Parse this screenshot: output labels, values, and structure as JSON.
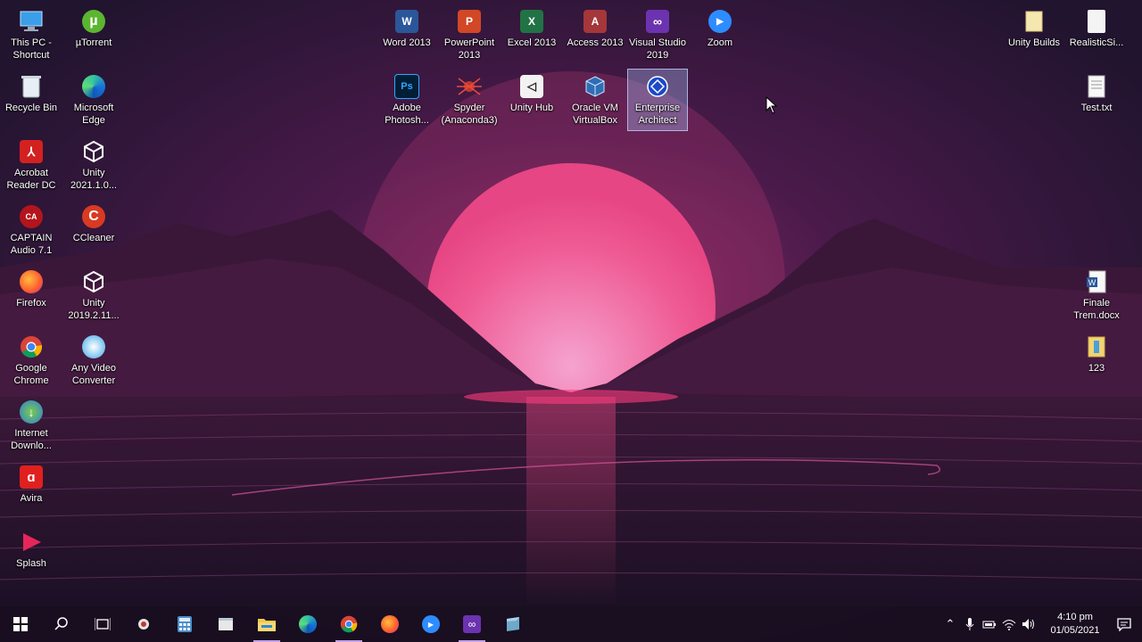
{
  "desktop": {
    "icons": {
      "this_pc": "This PC -\nShortcut",
      "utorrent": "µTorrent",
      "recycle_bin": "Recycle Bin",
      "edge": "Microsoft\nEdge",
      "acrobat": "Acrobat\nReader DC",
      "unity_2021": "Unity\n2021.1.0...",
      "captain_audio": "CAPTAIN\nAudio 7.1",
      "ccleaner": "CCleaner",
      "firefox": "Firefox",
      "unity_2019": "Unity\n2019.2.11...",
      "chrome": "Google\nChrome",
      "any_video": "Any Video\nConverter",
      "idm": "Internet\nDownlo...",
      "avira": "Avira",
      "splash": "Splash",
      "word": "Word 2013",
      "powerpoint": "PowerPoint\n2013",
      "excel": "Excel 2013",
      "access": "Access 2013",
      "visual_studio": "Visual Studio\n2019",
      "zoom": "Zoom",
      "photoshop": "Adobe\nPhotosh...",
      "spyder": "Spyder\n(Anaconda3)",
      "unity_hub": "Unity Hub",
      "virtualbox": "Oracle VM\nVirtualBox",
      "enterprise_architect": "Enterprise\nArchitect",
      "unity_builds": "Unity Builds",
      "realistic": "RealisticSi...",
      "test_txt": "Test.txt",
      "finale": "Finale\nTrem.docx",
      "folder_123": "123"
    }
  },
  "taskbar": {
    "clock_time": "4:10 pm",
    "clock_date": "01/05/2021",
    "apps": [
      "start",
      "search",
      "task-view",
      "spyder",
      "calculator",
      "notepad",
      "file-explorer",
      "edge",
      "chrome",
      "firefox",
      "zoom",
      "visual-studio",
      "enterprise-architect"
    ]
  },
  "colors": {
    "sun": "#f0508a",
    "accent": "#c6a1e8",
    "selection": "#adc6ff"
  }
}
